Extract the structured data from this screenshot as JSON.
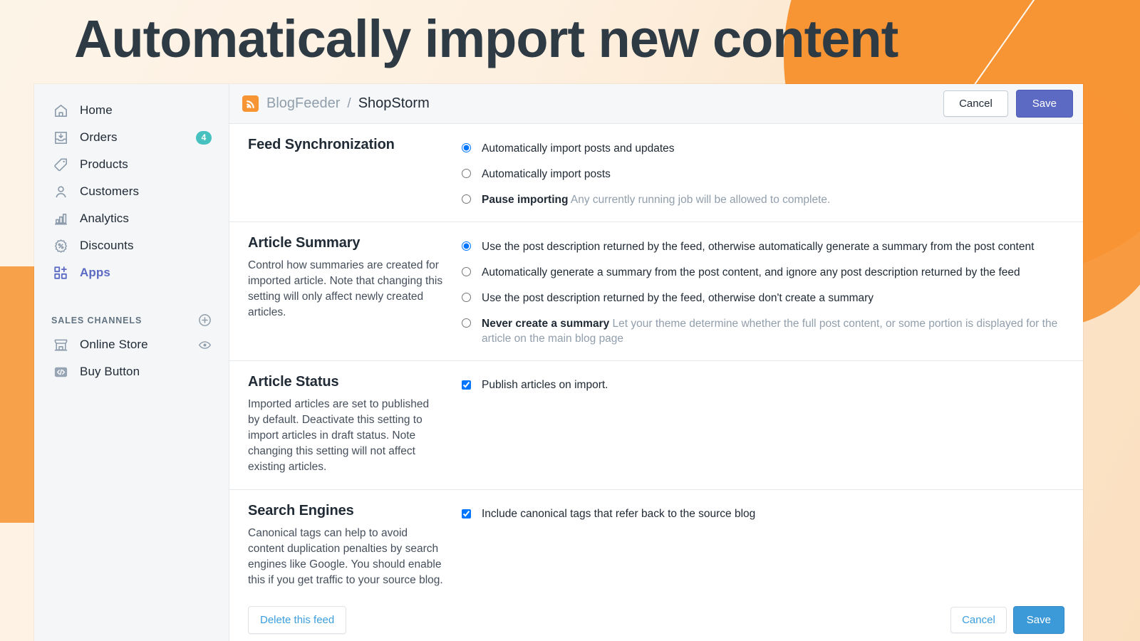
{
  "headline": "Automatically import new content",
  "colors": {
    "accent_orange": "#f79434",
    "sidebar_active": "#5c6ac4",
    "badge_teal": "#47c1bf",
    "save_top": "#5c6ac4",
    "save_bottom": "#3d9ad9",
    "link_blue": "#3b9ede"
  },
  "sidebar": {
    "items": [
      {
        "label": "Home",
        "icon": "home-icon",
        "badge": null,
        "active": false
      },
      {
        "label": "Orders",
        "icon": "orders-icon",
        "badge": "4",
        "active": false
      },
      {
        "label": "Products",
        "icon": "products-icon",
        "badge": null,
        "active": false
      },
      {
        "label": "Customers",
        "icon": "customers-icon",
        "badge": null,
        "active": false
      },
      {
        "label": "Analytics",
        "icon": "analytics-icon",
        "badge": null,
        "active": false
      },
      {
        "label": "Discounts",
        "icon": "discounts-icon",
        "badge": null,
        "active": false
      },
      {
        "label": "Apps",
        "icon": "apps-icon",
        "badge": null,
        "active": true
      }
    ],
    "sales_channels": {
      "title": "SALES CHANNELS",
      "add_icon": "plus-circle-icon",
      "items": [
        {
          "label": "Online Store",
          "icon": "storefront-icon",
          "trailing_icon": "eye-icon"
        },
        {
          "label": "Buy Button",
          "icon": "code-icon",
          "trailing_icon": null
        }
      ]
    }
  },
  "topbar": {
    "rss_icon": "rss-icon",
    "app_name": "BlogFeeder",
    "separator": "/",
    "current": "ShopStorm",
    "cancel_label": "Cancel",
    "save_label": "Save"
  },
  "sections": [
    {
      "title": "Feed Synchronization",
      "description": "",
      "control_type": "radio",
      "options": [
        {
          "label": "Automatically import posts and updates",
          "hint": "",
          "selected": true
        },
        {
          "label": "Automatically import posts",
          "hint": "",
          "selected": false
        },
        {
          "label": "Pause importing",
          "hint": "Any currently running job will be allowed to complete.",
          "selected": false,
          "bold_label": true
        }
      ]
    },
    {
      "title": "Article Summary",
      "description": "Control how summaries are created for imported article. Note that changing this setting will only affect newly created articles.",
      "control_type": "radio",
      "options": [
        {
          "label": "Use the post description returned by the feed, otherwise automatically generate a summary from the post content",
          "hint": "",
          "selected": true
        },
        {
          "label": "Automatically generate a summary from the post content, and ignore any post description returned by the feed",
          "hint": "",
          "selected": false
        },
        {
          "label": "Use the post description returned by the feed, otherwise don't create a summary",
          "hint": "",
          "selected": false
        },
        {
          "label": "Never create a summary",
          "hint": "Let your theme determine whether the full post content, or some portion is displayed for the article on the main blog page",
          "selected": false,
          "bold_label": true
        }
      ]
    },
    {
      "title": "Article Status",
      "description": "Imported articles are set to published by default. Deactivate this setting to import articles in draft status. Note changing this setting will not affect existing articles.",
      "control_type": "checkbox",
      "options": [
        {
          "label": "Publish articles on import.",
          "hint": "",
          "selected": true
        }
      ]
    },
    {
      "title": "Search Engines",
      "description": "Canonical tags can help to avoid content duplication penalties by search engines like Google. You should enable this if you get traffic to your source blog.",
      "control_type": "checkbox",
      "options": [
        {
          "label": "Include canonical tags that refer back to the source blog",
          "hint": "",
          "selected": true
        }
      ]
    }
  ],
  "footer": {
    "delete_label": "Delete this feed",
    "cancel_label": "Cancel",
    "save_label": "Save"
  }
}
